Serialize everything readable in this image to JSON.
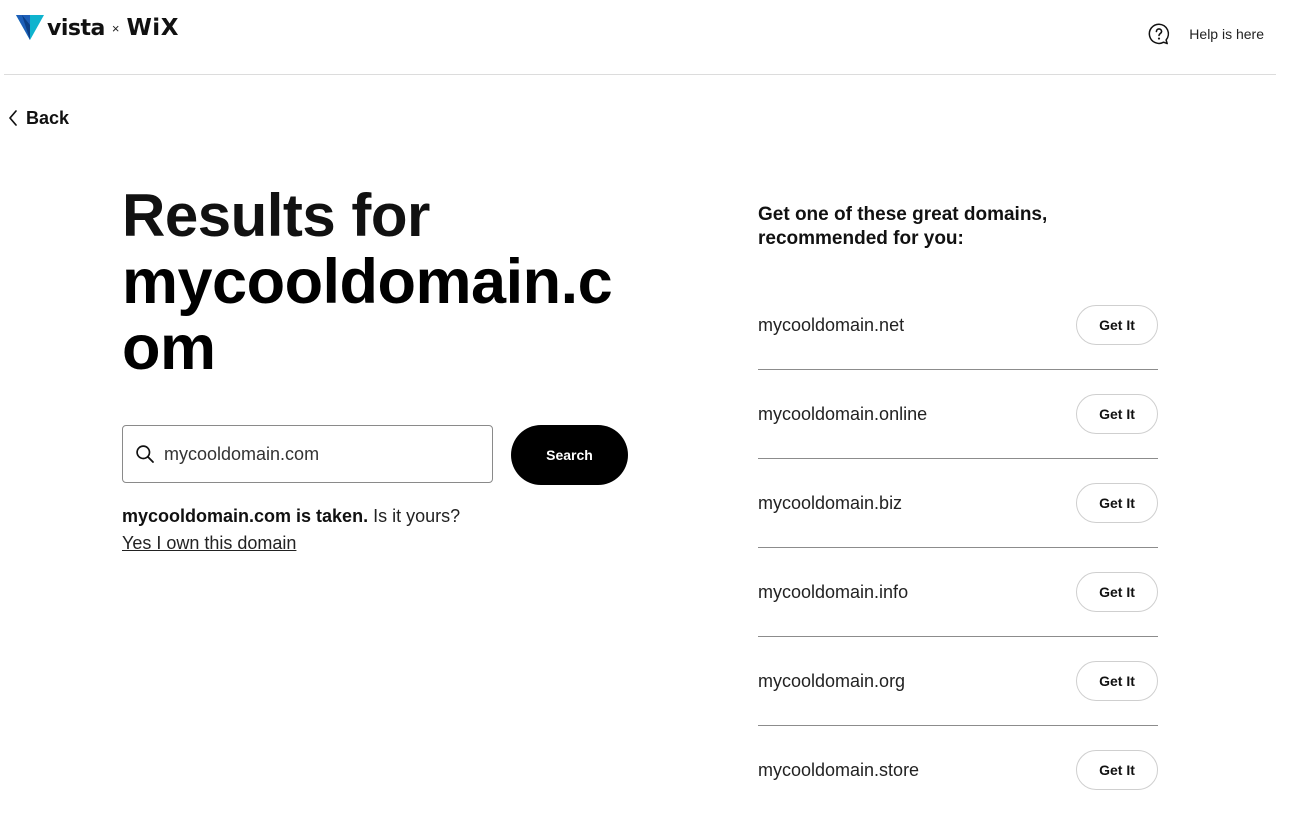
{
  "header": {
    "logo": {
      "brand_left": "vista",
      "separator": "×",
      "brand_right": "WiX",
      "mark_icon": "vista-triangle-logo",
      "mark_colors": [
        "#1d5fb8",
        "#0fb3ce",
        "#0b3f86"
      ]
    },
    "help": {
      "icon": "help-bubble-icon",
      "label": "Help is here"
    }
  },
  "back": {
    "icon": "chevron-left-icon",
    "label": "Back"
  },
  "results": {
    "prefix": "Results for",
    "domain": "mycooldomain.com"
  },
  "search": {
    "icon": "search-icon",
    "value": "mycooldomain.com",
    "button_label": "Search"
  },
  "availability": {
    "taken_text": "mycooldomain.com is taken.",
    "question": "Is it yours?",
    "own_link": "Yes I own this domain"
  },
  "recommendations": {
    "title": "Get one of these great domains, recommended for you:",
    "items": [
      {
        "domain": "mycooldomain.net",
        "button": "Get It"
      },
      {
        "domain": "mycooldomain.online",
        "button": "Get It"
      },
      {
        "domain": "mycooldomain.biz",
        "button": "Get It"
      },
      {
        "domain": "mycooldomain.info",
        "button": "Get It"
      },
      {
        "domain": "mycooldomain.org",
        "button": "Get It"
      },
      {
        "domain": "mycooldomain.store",
        "button": "Get It"
      }
    ]
  },
  "colors": {
    "primary_button": "#000000",
    "divider": "#8c8c8c",
    "text": "#222222"
  }
}
